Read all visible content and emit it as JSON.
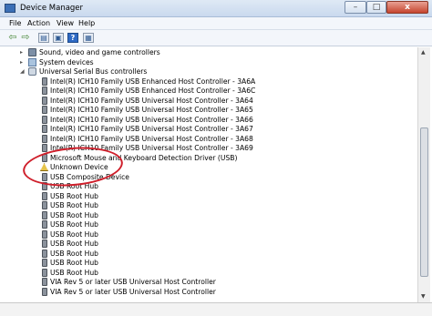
{
  "window": {
    "title": "Device Manager",
    "controls": {
      "minimize": "–",
      "maximize": "□",
      "close": "x"
    }
  },
  "menubar": {
    "items": [
      "File",
      "Action",
      "View",
      "Help"
    ]
  },
  "toolbar": {
    "buttons": [
      "back-icon",
      "forward-icon",
      "properties-icon",
      "show-hide-icon",
      "help-icon",
      "scan-icon"
    ]
  },
  "tree": {
    "categories": [
      {
        "label": "Sound, video and game controllers",
        "expander": "▸",
        "icon": "speaker-icon"
      },
      {
        "label": "System devices",
        "expander": "▸",
        "icon": "system-devices-icon"
      },
      {
        "label": "Universal Serial Bus controllers",
        "expander": "◢",
        "icon": "usb-controllers-icon"
      }
    ],
    "usb_devices": [
      "Intel(R) ICH10 Family USB Enhanced Host Controller - 3A6A",
      "Intel(R) ICH10 Family USB Enhanced Host Controller - 3A6C",
      "Intel(R) ICH10 Family USB Universal Host Controller - 3A64",
      "Intel(R) ICH10 Family USB Universal Host Controller - 3A65",
      "Intel(R) ICH10 Family USB Universal Host Controller - 3A66",
      "Intel(R) ICH10 Family USB Universal Host Controller - 3A67",
      "Intel(R) ICH10 Family USB Universal Host Controller - 3A68",
      "Intel(R) ICH10 Family USB Universal Host Controller - 3A69",
      "Microsoft Mouse and Keyboard Detection Driver (USB)",
      "Unknown Device",
      "USB Composite Device",
      "USB Root Hub",
      "USB Root Hub",
      "USB Root Hub",
      "USB Root Hub",
      "USB Root Hub",
      "USB Root Hub",
      "USB Root Hub",
      "USB Root Hub",
      "USB Root Hub",
      "USB Root Hub",
      "VIA Rev 5 or later USB Universal Host Controller",
      "VIA Rev 5 or later USB Universal Host Controller"
    ],
    "warning_device_index": 9
  },
  "colors": {
    "annotation_circle": "#cf1f2b",
    "titlebar": "#dfe9f5"
  }
}
